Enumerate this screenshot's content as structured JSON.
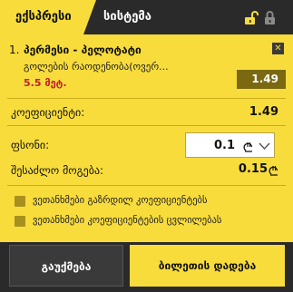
{
  "tabs": {
    "express_label": "ექსპრესი",
    "system_label": "სისტემა"
  },
  "icons": {
    "unlock": "unlock-icon",
    "lock": "lock-icon",
    "close": "close-icon",
    "currency": "lari-icon",
    "chevron": "chevron-down-icon"
  },
  "bet": {
    "number": "1.",
    "event": "პერმესი - პელოტატი",
    "market": "გოლების რაოდენობა(ოვერ...",
    "line": "5.5 მეტ.",
    "odds": "1.49"
  },
  "summary": {
    "coef_label": "კოეფიციენტი:",
    "coef_value": "1.49",
    "stake_label": "ფსონი:",
    "stake_value": "0.1",
    "win_label": "შესაძლო მოგება:",
    "win_value": "0.15"
  },
  "options": [
    {
      "label": "ვეთანხმები გაზრდილ კოეფიციენტებს"
    },
    {
      "label": "ვეთანხმები კოეფიციენტების ცვლილებას"
    }
  ],
  "buttons": {
    "cancel_label": "გაუქმება",
    "place_label": "ბილეთის დადება"
  },
  "colors": {
    "accent": "#f8dc3c",
    "dark": "#2a2a2a",
    "odds_box": "#7a6910",
    "line_red": "#c0202c"
  }
}
